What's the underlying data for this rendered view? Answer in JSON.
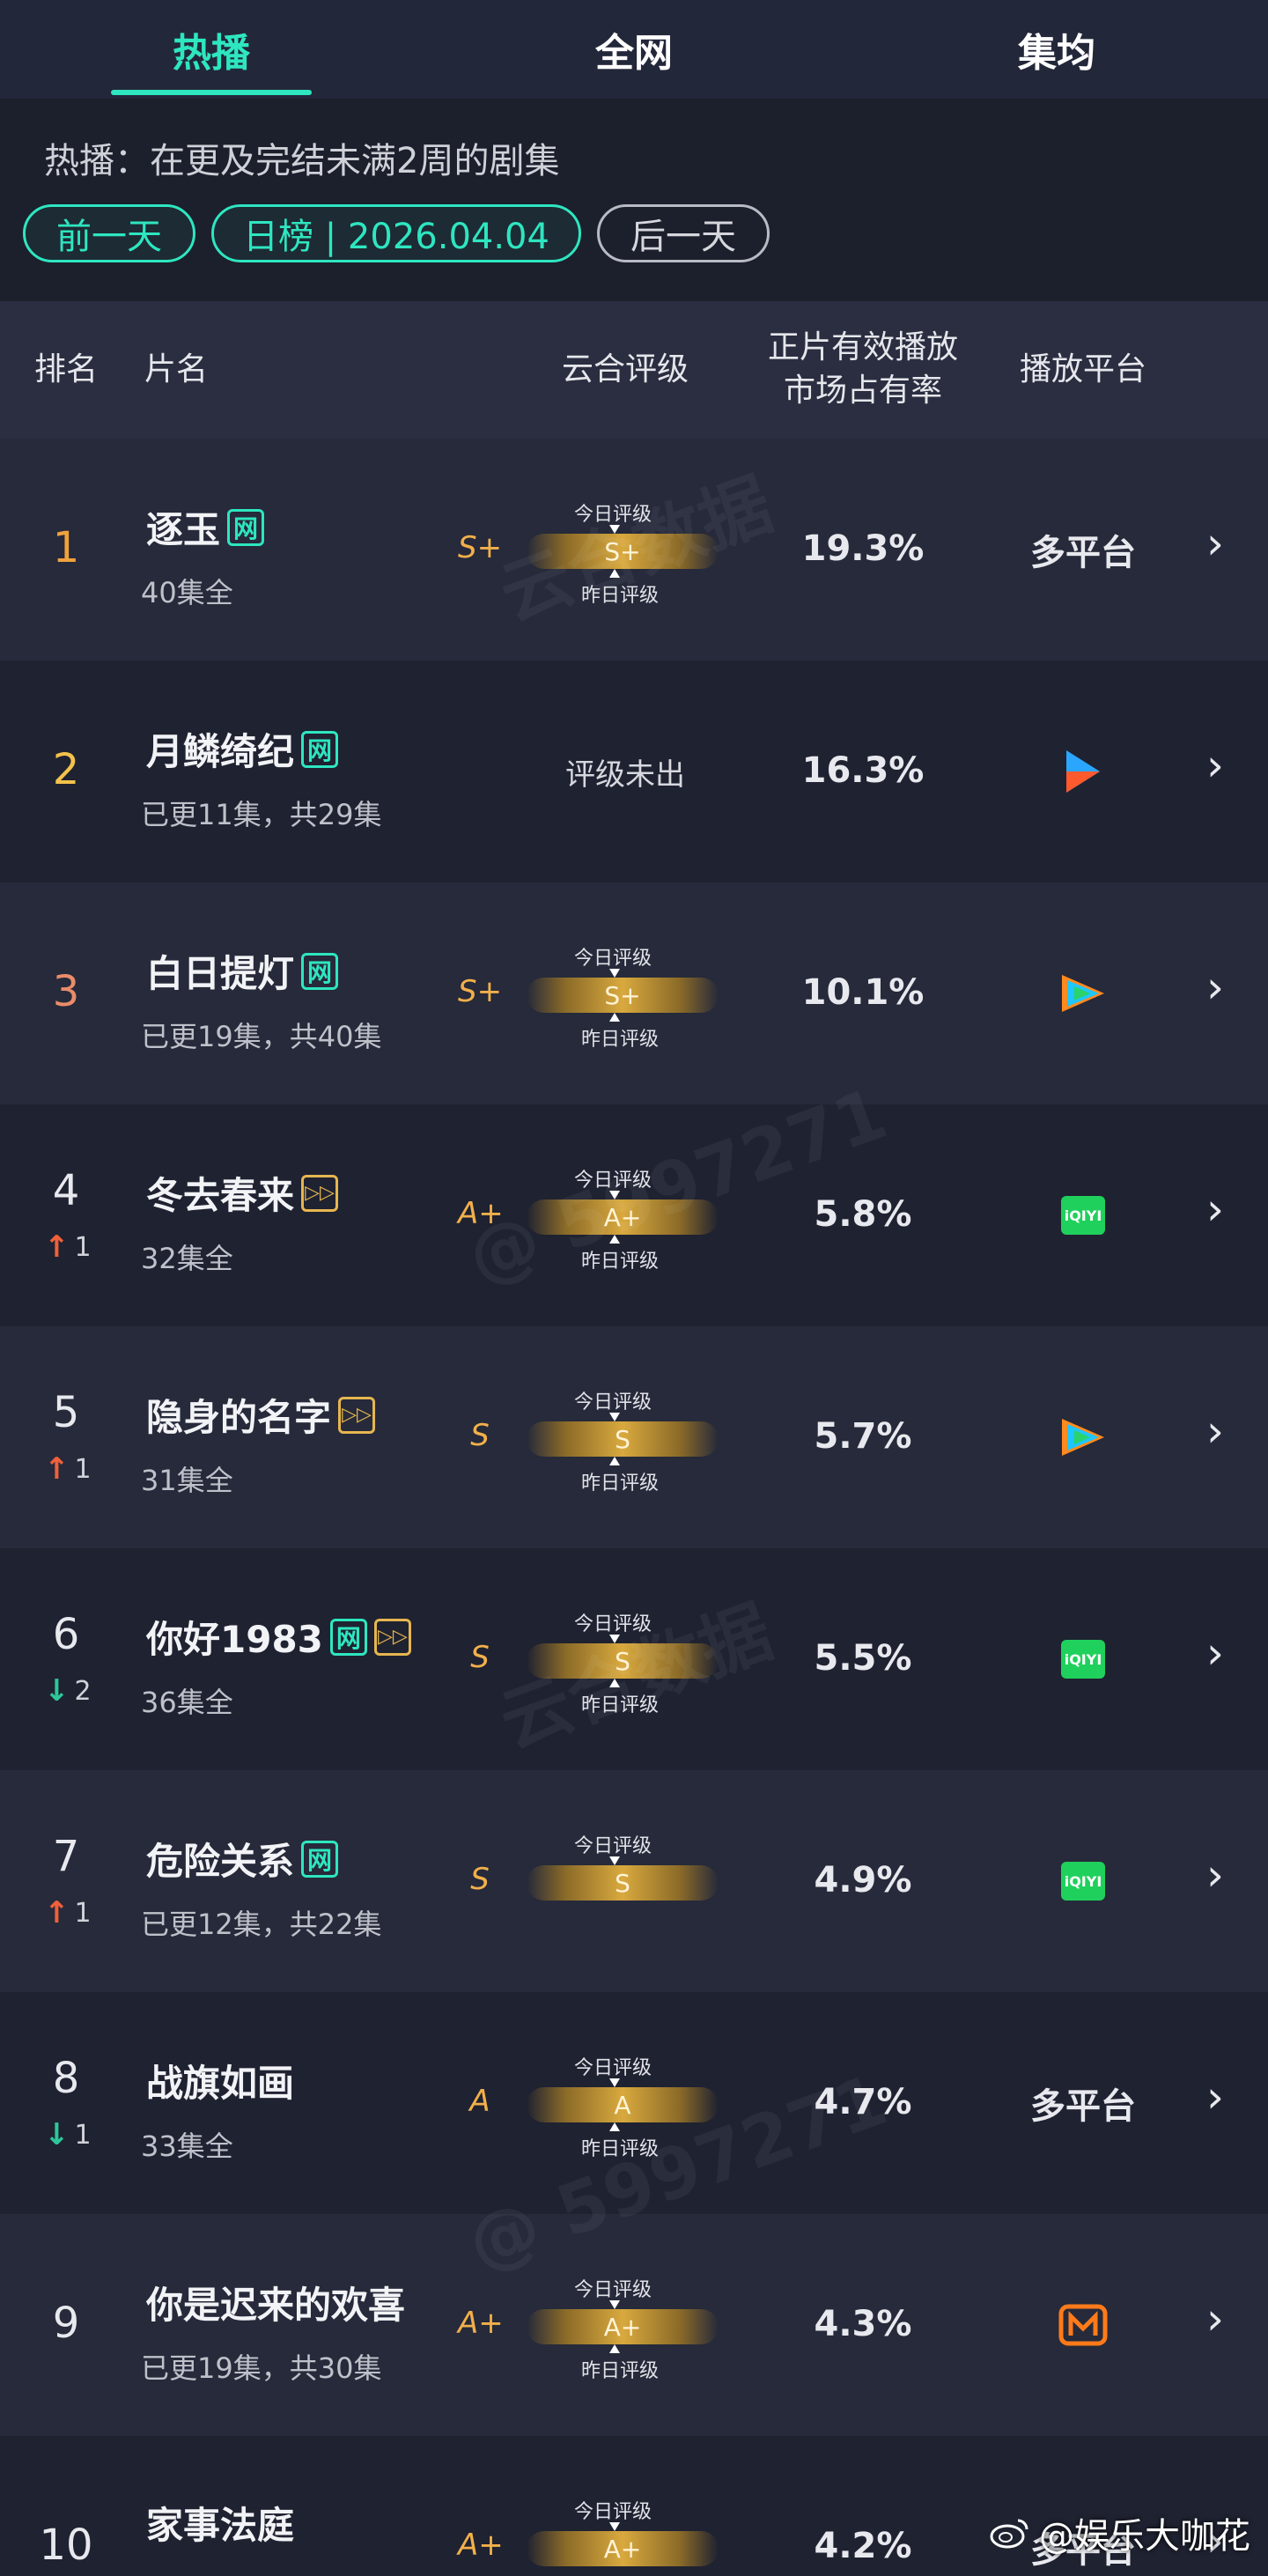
{
  "tabs": [
    {
      "label": "热播"
    },
    {
      "label": "全网"
    },
    {
      "label": "集均"
    }
  ],
  "description": "热播：在更及完结未满2周的剧集",
  "date_nav": {
    "prev": "前一天",
    "current": "日榜 | 2026.04.04",
    "next": "后一天"
  },
  "table_header": {
    "rank": "排名",
    "title": "片名",
    "grade": "云合评级",
    "share_line1": "正片有效播放",
    "share_line2": "市场占有率",
    "platform": "播放平台"
  },
  "labels": {
    "today": "今日评级",
    "yesterday": "昨日评级",
    "no_grade": "评级未出",
    "chevron": "›",
    "net_tag": "网",
    "fwd_tag": "▷"
  },
  "rows": [
    {
      "rank": "1",
      "trend": "",
      "trend_dir": "",
      "title": "逐玉",
      "tags": [
        "net"
      ],
      "episodes": "40集全",
      "grade": "S+",
      "grade_state": "rated",
      "share": "19.3%",
      "platform": "多平台",
      "platform_icon": ""
    },
    {
      "rank": "2",
      "trend": "",
      "trend_dir": "",
      "title": "月鳞绮纪",
      "tags": [
        "net"
      ],
      "episodes": "已更11集，共29集",
      "grade": "",
      "grade_state": "none",
      "share": "16.3%",
      "platform": "",
      "platform_icon": "youku-icon"
    },
    {
      "rank": "3",
      "trend": "",
      "trend_dir": "",
      "title": "白日提灯",
      "tags": [
        "net"
      ],
      "episodes": "已更19集，共40集",
      "grade": "S+",
      "grade_state": "rated",
      "share": "10.1%",
      "platform": "",
      "platform_icon": "tencent-video-icon"
    },
    {
      "rank": "4",
      "trend": "1",
      "trend_dir": "up",
      "title": "冬去春来",
      "tags": [
        "fwd"
      ],
      "episodes": "32集全",
      "grade": "A+",
      "grade_state": "rated",
      "share": "5.8%",
      "platform": "",
      "platform_icon": "iqiyi-icon",
      "platform_text": "iQIYI"
    },
    {
      "rank": "5",
      "trend": "1",
      "trend_dir": "up",
      "title": "隐身的名字",
      "tags": [
        "fwd"
      ],
      "episodes": "31集全",
      "grade": "S",
      "grade_state": "rated",
      "share": "5.7%",
      "platform": "",
      "platform_icon": "tencent-video-icon"
    },
    {
      "rank": "6",
      "trend": "2",
      "trend_dir": "down",
      "title": "你好1983",
      "tags": [
        "net",
        "fwd"
      ],
      "episodes": "36集全",
      "grade": "S",
      "grade_state": "rated",
      "share": "5.5%",
      "platform": "",
      "platform_icon": "iqiyi-icon",
      "platform_text": "iQIYI"
    },
    {
      "rank": "7",
      "trend": "1",
      "trend_dir": "up",
      "title": "危险关系",
      "tags": [
        "net"
      ],
      "episodes": "已更12集，共22集",
      "grade": "S",
      "grade_state": "today_only",
      "share": "4.9%",
      "platform": "",
      "platform_icon": "iqiyi-icon",
      "platform_text": "iQIYI"
    },
    {
      "rank": "8",
      "trend": "1",
      "trend_dir": "down",
      "title": "战旗如画",
      "tags": [],
      "episodes": "33集全",
      "grade": "A",
      "grade_state": "rated",
      "share": "4.7%",
      "platform": "多平台",
      "platform_icon": ""
    },
    {
      "rank": "9",
      "trend": "",
      "trend_dir": "",
      "title": "你是迟来的欢喜",
      "tags": [],
      "episodes": "已更19集，共30集",
      "grade": "A+",
      "grade_state": "rated",
      "share": "4.3%",
      "platform": "",
      "platform_icon": "mango-tv-icon"
    },
    {
      "rank": "10",
      "trend": "",
      "trend_dir": "",
      "title": "家事法庭",
      "tags": [],
      "episodes": "",
      "grade": "A+",
      "grade_state": "today_only",
      "share": "4.2%",
      "platform": "多平台",
      "platform_icon": ""
    }
  ],
  "watermark_text": "云合数据",
  "watermark_id": "@ 5997271",
  "weibo_handle": "@娱乐大咖花"
}
